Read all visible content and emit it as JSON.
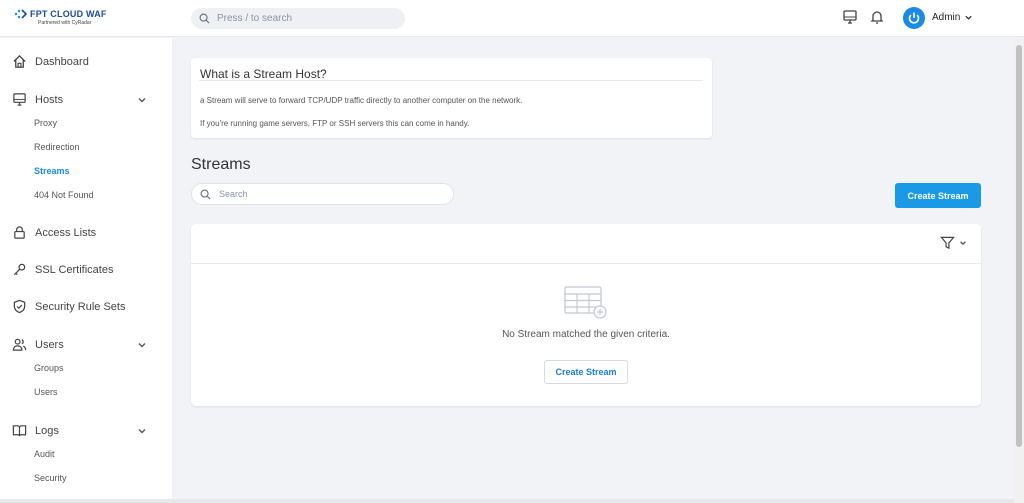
{
  "brand": {
    "name": "FPT CLOUD  WAF",
    "tagline": "Partnered with CyRadar",
    "color": "#1a4c9c"
  },
  "topbar": {
    "search_placeholder": "Press / to search",
    "user_name": "Admin",
    "icons": [
      "monitor-icon",
      "bell-icon",
      "power-icon",
      "chevron-down-icon"
    ]
  },
  "sidebar": {
    "dashboard": "Dashboard",
    "hosts": "Hosts",
    "hosts_items": [
      "Proxy",
      "Redirection",
      "Streams",
      "404 Not Found"
    ],
    "access_lists": "Access Lists",
    "ssl": "SSL Certificates",
    "security_rules": "Security Rule Sets",
    "users": "Users",
    "users_items": [
      "Groups",
      "Users"
    ],
    "logs": "Logs",
    "logs_items": [
      "Audit",
      "Security"
    ],
    "active_item": "Streams"
  },
  "info_card": {
    "title": "What is a Stream Host?",
    "line1": "a Stream will serve to forward TCP/UDP traffic directly to another computer on the network.",
    "line2": "If you're running game servers, FTP or SSH servers this can come in handy."
  },
  "main": {
    "heading": "Streams",
    "search_placeholder": "Search",
    "create_button": "Create Stream",
    "empty_message": "No Stream matched the given criteria.",
    "empty_create_button": "Create Stream"
  },
  "colors": {
    "accent": "#1a9ae6",
    "background": "#f1f3f6"
  }
}
